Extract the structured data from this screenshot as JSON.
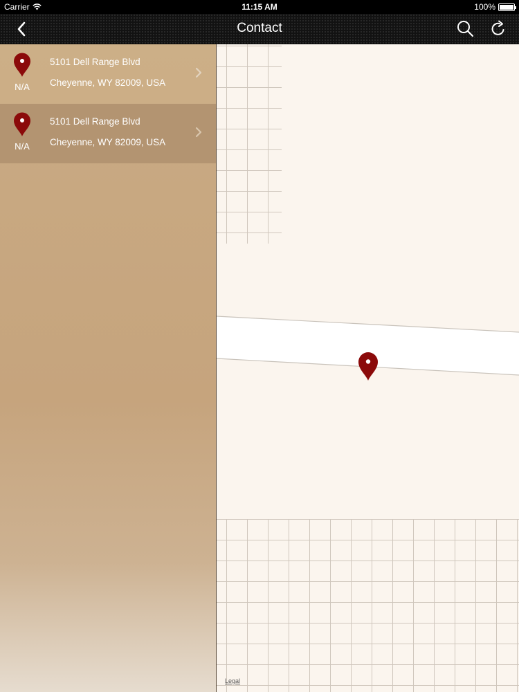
{
  "status_bar": {
    "carrier": "Carrier",
    "time": "11:15 AM",
    "battery": "100%"
  },
  "nav": {
    "title": "Contact",
    "back_icon": "chevron-left-icon",
    "search_icon": "search-icon",
    "refresh_icon": "refresh-icon"
  },
  "locations": [
    {
      "address_line1": "5101 Dell Range Blvd",
      "address_line2": "Cheyenne, WY 82009, USA",
      "distance": "N/A"
    },
    {
      "address_line1": "5101 Dell Range Blvd",
      "address_line2": "Cheyenne, WY 82009, USA",
      "distance": "N/A"
    }
  ],
  "map": {
    "legal_label": "Legal"
  },
  "colors": {
    "pin": "#8b0a0a",
    "nav_bg": "#121212",
    "map_bg": "#fbf5ee",
    "sidebar_bg": "#c6a47d"
  }
}
